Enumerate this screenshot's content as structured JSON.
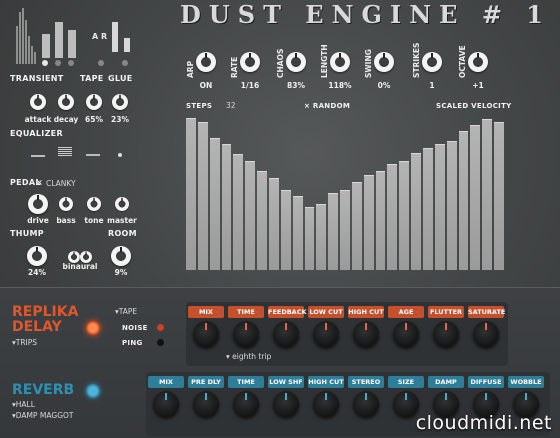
{
  "title": "DUST ENGINE # 1",
  "top_left": {
    "sections": {
      "transient": "TRANSIENT",
      "tape": "TAPE",
      "glue": "GLUE",
      "equalizer": "EQUALIZER",
      "pedal": "PEDAL",
      "thump": "THUMP",
      "room": "ROOM"
    },
    "tape_ar": "A R",
    "knobs1": [
      {
        "label": "attack",
        "value": ""
      },
      {
        "label": "decay",
        "value": ""
      },
      {
        "label": "",
        "value": "65%"
      },
      {
        "label": "",
        "value": "23%"
      }
    ],
    "pedal_x": "×",
    "pedal_name": "CLANKY",
    "pedal_knobs": [
      "drive",
      "bass",
      "tone",
      "master"
    ],
    "thump_value": "24%",
    "binaural": "binaural",
    "room_value": "9%"
  },
  "params": [
    {
      "label": "ARP",
      "value": "ON"
    },
    {
      "label": "RATE",
      "value": "1/16"
    },
    {
      "label": "CHAOS",
      "value": "83%"
    },
    {
      "label": "LENGTH",
      "value": "118%"
    },
    {
      "label": "SWING",
      "value": "0%"
    },
    {
      "label": "STRIKES",
      "value": "1"
    },
    {
      "label": "OCTAVE",
      "value": "+1"
    }
  ],
  "sequencer": {
    "steps_label": "STEPS",
    "steps_value": "32",
    "random_label": "× RANDOM",
    "velocity_label": "SCALED VELOCITY",
    "bars": [
      0.99,
      0.96,
      0.86,
      0.82,
      0.75,
      0.71,
      0.64,
      0.6,
      0.52,
      0.48,
      0.41,
      0.43,
      0.5,
      0.52,
      0.57,
      0.62,
      0.64,
      0.69,
      0.71,
      0.76,
      0.79,
      0.82,
      0.84,
      0.9,
      0.94,
      0.98,
      0.96
    ]
  },
  "replika": {
    "name_line1": "REPLIKA",
    "name_line2": "DELAY",
    "preset": "TRIPS",
    "tape": "TAPE",
    "noise": "NOISE",
    "ping": "PING",
    "params": [
      "MIX",
      "TIME",
      "FEEDBACK",
      "LOW CUT",
      "HIGH CUT",
      "AGE",
      "FLUTTER",
      "SATURATE"
    ],
    "time_note": "eighth trip"
  },
  "reverb": {
    "name": "REVERB",
    "preset1": "HALL",
    "preset2": "DAMP MAGGOT",
    "params": [
      "MIX",
      "PRE DLY",
      "TIME",
      "LOW SHF",
      "HIGH CUT",
      "STEREO",
      "SIZE",
      "DAMP",
      "DIFFUSE",
      "WOBBLE"
    ]
  },
  "watermark": "cloudmidi.net",
  "colors": {
    "accent_red": "#e0562d",
    "accent_blue": "#2f8fb3",
    "knob_white": "#f4f4f4"
  }
}
